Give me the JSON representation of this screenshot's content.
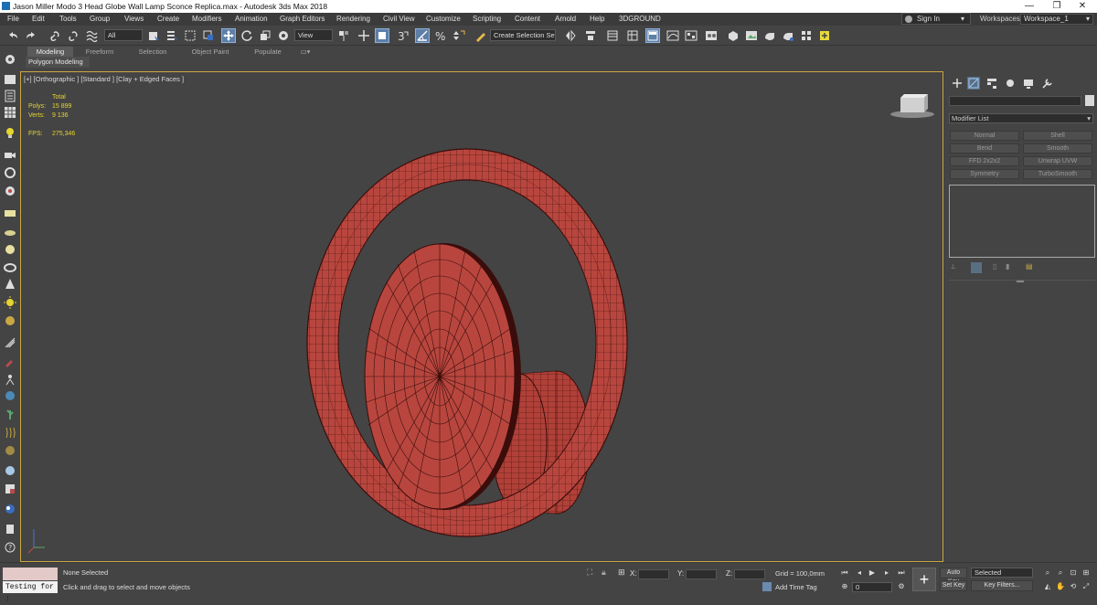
{
  "window": {
    "title": "Jason Miller Modo 3 Head Globe Wall Lamp Sconce Replica.max - Autodesk 3ds Max 2018",
    "minimize": "—",
    "restore": "❐",
    "close": "✕"
  },
  "menu": [
    "File",
    "Edit",
    "Tools",
    "Group",
    "Views",
    "Create",
    "Modifiers",
    "Animation",
    "Graph Editors",
    "Rendering",
    "Civil View",
    "Customize",
    "Scripting",
    "Content",
    "Arnold",
    "Help",
    "3DGROUND"
  ],
  "account": {
    "signin": "Sign In",
    "workspaces_label": "Workspaces:",
    "workspace": "Workspace_1"
  },
  "toolbar": {
    "selection_filter": "All",
    "ref_coord": "View",
    "named_selection": "Create Selection Se",
    "icons": [
      "undo-icon",
      "redo-icon",
      "link-icon",
      "unlink-icon",
      "bind-spacewarp-icon",
      "select-object-icon",
      "select-by-name-icon",
      "rect-region-icon",
      "window-crossing-icon",
      "select-move-icon",
      "select-rotate-icon",
      "select-scale-icon",
      "select-place-icon",
      "pivot-icon",
      "manipulate-icon",
      "keyboard-shortcut-icon",
      "snap-toggle-icon",
      "angle-snap-icon",
      "percent-snap-icon",
      "spinner-snap-icon",
      "edit-named-sel-icon",
      "mirror-icon",
      "align-icon",
      "scene-explorer-icon",
      "layer-explorer-icon",
      "ribbon-toggle-icon",
      "curve-editor-icon",
      "schematic-view-icon",
      "material-editor-icon",
      "render-setup-icon",
      "rendered-frame-icon",
      "render-icon",
      "render-iterative-icon",
      "a360-icon",
      "max-script-icon"
    ]
  },
  "ribbon": {
    "tabs": [
      "Modeling",
      "Freeform",
      "Selection",
      "Object Paint",
      "Populate"
    ],
    "active_tab": "Modeling",
    "panel": "Polygon Modeling"
  },
  "viewport": {
    "label": "[+] [Orthographic ] [Standard ] [Clay + Edged Faces ]",
    "stats": {
      "header": "Total",
      "polys_label": "Polys:",
      "polys": "15 899",
      "verts_label": "Verts:",
      "verts": "9 136",
      "fps_label": "FPS:",
      "fps": "275,346"
    },
    "mesh_color": "#b8463e",
    "wire_color": "#3a0d0b"
  },
  "command_panel": {
    "tabs": [
      "create-tab-icon",
      "modify-tab-icon",
      "hierarchy-tab-icon",
      "motion-tab-icon",
      "display-tab-icon",
      "utilities-tab-icon"
    ],
    "modifier_list": "Modifier List",
    "modifier_buttons": [
      "Normal",
      "Shell",
      "Bend",
      "Smooth",
      "FFD 2x2x2",
      "Unwrap UVW",
      "Symmetry",
      "TurboSmooth"
    ]
  },
  "status": {
    "maxscript_prompt": "Testing for :",
    "selection": "None Selected",
    "prompt": "Click and drag to select and move objects",
    "x_label": "X:",
    "y_label": "Y:",
    "z_label": "Z:",
    "grid": "Grid = 100,0mm",
    "add_time_tag": "Add Time Tag",
    "auto_key": "Auto Key",
    "set_key": "Set Key",
    "key_mode": "Selected",
    "key_filters": "Key Filters...",
    "frame": "0"
  }
}
